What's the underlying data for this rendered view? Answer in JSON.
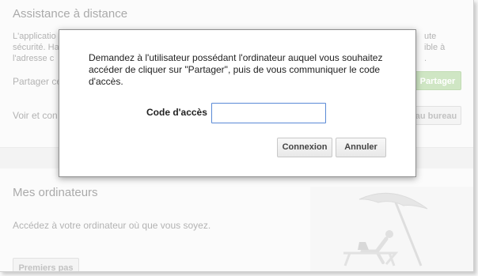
{
  "remote_assistance": {
    "title": "Assistance à distance",
    "desc_fragments": [
      "L'applicatio",
      "sécurité. Ha",
      "l'adresse c"
    ],
    "desc_right_fragments": [
      "ute",
      "ible à",
      "."
    ],
    "share_fragment": "Partager ce",
    "share_button": "Partager",
    "view_fragment": "Voir et con",
    "desktop_button": "au bureau"
  },
  "my_computers": {
    "title": "Mes ordinateurs",
    "subtitle": "Accédez à votre ordinateur où que vous soyez.",
    "getting_started_button": "Premiers pas"
  },
  "dialog": {
    "message": "Demandez à l'utilisateur possédant l'ordinateur auquel vous souhaitez accéder de cliquer sur \"Partager\", puis de vous communiquer le code d'accès.",
    "code_label": "Code d'accès",
    "code_value": "",
    "connect_button": "Connexion",
    "cancel_button": "Annuler"
  }
}
